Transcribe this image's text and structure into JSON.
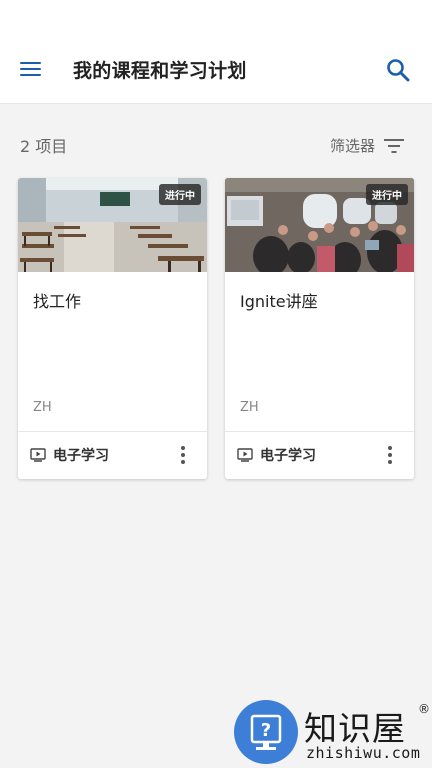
{
  "header": {
    "title": "我的课程和学习计划"
  },
  "toolbar": {
    "item_count": "2 项目",
    "filter_label": "筛选器"
  },
  "courses": [
    {
      "title": "找工作",
      "status": "进行中",
      "language": "ZH",
      "type": "电子学习"
    },
    {
      "title": "Ignite讲座",
      "status": "进行中",
      "language": "ZH",
      "type": "电子学习"
    }
  ],
  "watermark": {
    "name": "知识屋",
    "registered": "®",
    "url": "zhishiwu.com"
  },
  "colors": {
    "accent": "#1a5fa8",
    "background": "#f3f3f3",
    "badge": "#2b2b2b",
    "watermark_blue": "#3d7fd6"
  },
  "icons": {
    "menu": "hamburger-icon",
    "search": "search-icon",
    "filter": "filter-icon",
    "course_type": "play-screen-icon",
    "more": "more-vertical-icon"
  }
}
